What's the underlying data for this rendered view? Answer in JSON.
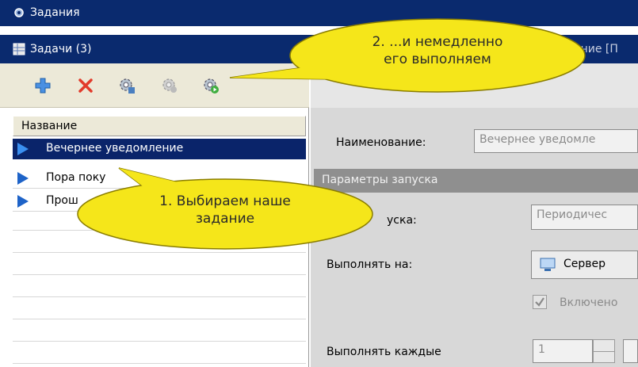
{
  "header": {
    "window_title": "Задания",
    "section_title": "Задачи (3)",
    "right_title_partial": "ение [П"
  },
  "toolbar": {
    "buttons": [
      {
        "name": "add",
        "icon": "plus-icon"
      },
      {
        "name": "delete",
        "icon": "cross-icon"
      },
      {
        "name": "task-settings",
        "icon": "gear-icon"
      },
      {
        "name": "disabled-action",
        "icon": "gear-icon"
      },
      {
        "name": "run",
        "icon": "gear-run-icon"
      }
    ]
  },
  "list": {
    "column_header": "Название",
    "items": [
      {
        "label": "Вечернее уведомление",
        "selected": true
      },
      {
        "label": "Пора поку",
        "selected": false
      },
      {
        "label": "Прош",
        "selected": false
      }
    ]
  },
  "form": {
    "name_label": "Наименование:",
    "name_value": "Вечернее уведомле",
    "params_section": "Параметры запуска",
    "launch_type_label_partial": "уска:",
    "launch_type_value": "Периодичес",
    "run_on_label": "Выполнять на:",
    "run_on_value": "Сервер",
    "enabled_label": "Включено",
    "enabled_checked": true,
    "repeat_label": "Выполнять каждые",
    "repeat_value": "1"
  },
  "callouts": {
    "step1": [
      "1. Выбираем наше",
      "задание"
    ],
    "step2": [
      "2. ...и немедленно",
      "его выполняем"
    ]
  },
  "colors": {
    "selection": "#0a246a",
    "callout_fill": "#f5e61a",
    "callout_stroke": "#8a7d00"
  }
}
